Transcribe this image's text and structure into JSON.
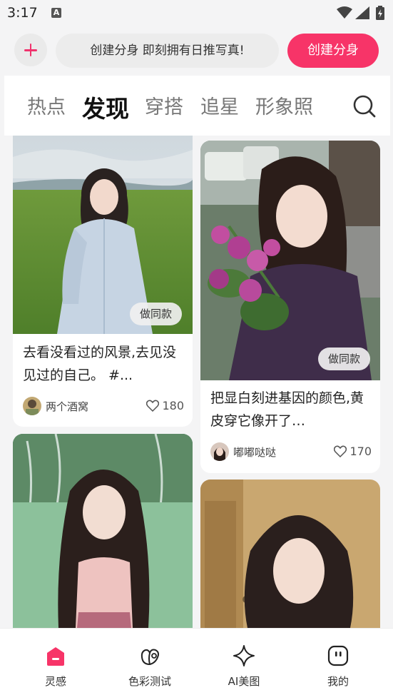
{
  "status_bar": {
    "time": "3:17"
  },
  "create_bar": {
    "banner_text": "创建分身 即刻拥有日推写真!",
    "button_label": "创建分身"
  },
  "tabs": [
    {
      "label": "热点",
      "active": false
    },
    {
      "label": "发现",
      "active": true
    },
    {
      "label": "穿搭",
      "active": false
    },
    {
      "label": "追星",
      "active": false
    },
    {
      "label": "形象照",
      "active": false
    }
  ],
  "feed": {
    "cards": [
      {
        "title": "去看没看过的风景,去见没见过的自己。 #...",
        "user": "两个酒窝",
        "likes": "180",
        "action": "做同款"
      },
      {
        "title": "把显白刻进基因的颜色,黄皮穿它像开了…",
        "user": "嘟嘟哒哒",
        "likes": "170",
        "action": "做同款"
      },
      {
        "title": "",
        "user": "",
        "likes": ""
      },
      {
        "title": "",
        "user": "",
        "likes": ""
      }
    ]
  },
  "bottom_nav": [
    {
      "label": "灵感",
      "icon": "inspiration-icon",
      "active": true
    },
    {
      "label": "色彩测试",
      "icon": "palette-icon",
      "active": false
    },
    {
      "label": "AI美图",
      "icon": "sparkle-icon",
      "active": false
    },
    {
      "label": "我的",
      "icon": "profile-icon",
      "active": false
    }
  ],
  "colors": {
    "accent": "#f73468",
    "background": "#f4f4f5"
  }
}
